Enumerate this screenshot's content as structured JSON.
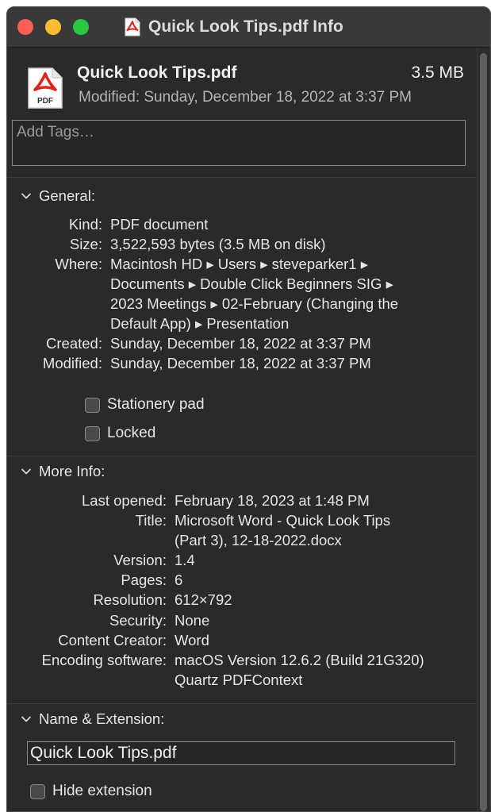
{
  "window": {
    "title": "Quick Look Tips.pdf Info",
    "traffic_lights": {
      "close": "#fe5f57",
      "minimize": "#febc2e",
      "zoom": "#28c840"
    }
  },
  "header": {
    "file_name": "Quick Look Tips.pdf",
    "file_size": "3.5 MB",
    "modified_line": "Modified: Sunday, December 18, 2022 at 3:37 PM",
    "icon_badge": "PDF",
    "tags_placeholder": "Add Tags…"
  },
  "general": {
    "heading": "General:",
    "rows": [
      {
        "label": "Kind:",
        "value": "PDF document"
      },
      {
        "label": "Size:",
        "value": "3,522,593 bytes (3.5 MB on disk)"
      },
      {
        "label": "Where:",
        "value": "Macintosh HD ▸ Users ▸ steveparker1 ▸"
      },
      {
        "label": "",
        "value": "Documents ▸ Double Click Beginners SIG ▸"
      },
      {
        "label": "",
        "value": "2023 Meetings ▸ 02-February (Changing the"
      },
      {
        "label": "",
        "value": "Default App) ▸ Presentation"
      },
      {
        "label": "Created:",
        "value": "Sunday, December 18, 2022 at 3:37 PM"
      },
      {
        "label": "Modified:",
        "value": "Sunday, December 18, 2022 at 3:37 PM"
      }
    ],
    "stationery_label": "Stationery pad",
    "stationery_checked": false,
    "locked_label": "Locked",
    "locked_checked": false
  },
  "more_info": {
    "heading": "More Info:",
    "rows": [
      {
        "label": "Last opened:",
        "value": "February 18, 2023 at 1:48 PM"
      },
      {
        "label": "Title:",
        "value": "Microsoft Word - Quick Look Tips"
      },
      {
        "label": "",
        "value": "(Part 3), 12-18-2022.docx"
      },
      {
        "label": "Version:",
        "value": "1.4"
      },
      {
        "label": "Pages:",
        "value": "6"
      },
      {
        "label": "Resolution:",
        "value": "612×792"
      },
      {
        "label": "Security:",
        "value": "None"
      },
      {
        "label": "Content Creator:",
        "value": "Word"
      },
      {
        "label": "Encoding software:",
        "value": "macOS Version 12.6.2 (Build 21G320)"
      },
      {
        "label": "",
        "value": "Quartz PDFContext"
      }
    ]
  },
  "name_extension": {
    "heading": "Name & Extension:",
    "name_value": "Quick Look Tips.pdf",
    "hide_extension_label": "Hide extension",
    "hide_extension_checked": false
  }
}
